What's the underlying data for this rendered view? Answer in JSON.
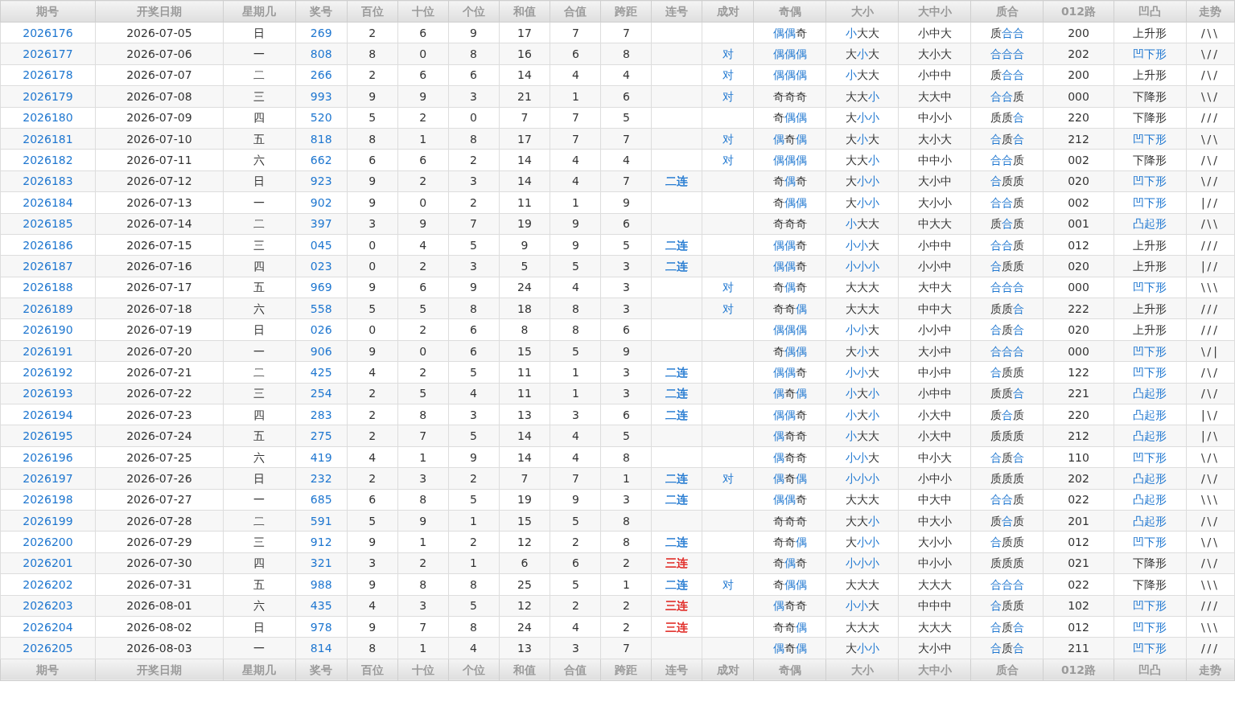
{
  "header": [
    "期号",
    "开奖日期",
    "星期几",
    "奖号",
    "百位",
    "十位",
    "个位",
    "和值",
    "合值",
    "跨距",
    "连号",
    "成对",
    "奇偶",
    "大小",
    "大中小",
    "质合",
    "012路",
    "凹凸",
    "走势"
  ],
  "rows": [
    {
      "issue": "2026176",
      "date": "2026-07-05",
      "weekday": "日",
      "number": "269",
      "hundreds": "2",
      "tens": "6",
      "units": "9",
      "sum": "17",
      "sum_tail": "7",
      "span": "7",
      "odd_even": [
        {
          "t": "偶偶",
          "hot": true
        },
        {
          "t": "奇",
          "hot": false
        }
      ],
      "big_small": [
        {
          "t": "小",
          "hot": true
        },
        {
          "t": "大大",
          "hot": false
        }
      ],
      "big_mid_small": "小中大",
      "prime": [
        {
          "t": "质",
          "hot": false
        },
        {
          "t": "合合",
          "hot": true
        }
      ],
      "road": "200",
      "shape": {
        "text": "上升形",
        "hot": false
      },
      "trend": "/\\\\"
    },
    {
      "issue": "2026177",
      "date": "2026-07-06",
      "weekday": "一",
      "number": "808",
      "hundreds": "8",
      "tens": "0",
      "units": "8",
      "sum": "16",
      "sum_tail": "6",
      "span": "8",
      "pair": "对",
      "odd_even": [
        {
          "t": "偶偶偶",
          "hot": true
        }
      ],
      "big_small": [
        {
          "t": "大",
          "hot": false
        },
        {
          "t": "小",
          "hot": true
        },
        {
          "t": "大",
          "hot": false
        }
      ],
      "big_mid_small": "大小大",
      "prime": [
        {
          "t": "合合合",
          "hot": true
        }
      ],
      "road": "202",
      "shape": {
        "text": "凹下形",
        "hot": true
      },
      "trend": "\\//"
    },
    {
      "issue": "2026178",
      "date": "2026-07-07",
      "weekday": "二",
      "number": "266",
      "hundreds": "2",
      "tens": "6",
      "units": "6",
      "sum": "14",
      "sum_tail": "4",
      "span": "4",
      "pair": "对",
      "odd_even": [
        {
          "t": "偶偶偶",
          "hot": true
        }
      ],
      "big_small": [
        {
          "t": "小",
          "hot": true
        },
        {
          "t": "大大",
          "hot": false
        }
      ],
      "big_mid_small": "小中中",
      "prime": [
        {
          "t": "质",
          "hot": false
        },
        {
          "t": "合合",
          "hot": true
        }
      ],
      "road": "200",
      "shape": {
        "text": "上升形",
        "hot": false
      },
      "trend": "/\\/"
    },
    {
      "issue": "2026179",
      "date": "2026-07-08",
      "weekday": "三",
      "number": "993",
      "hundreds": "9",
      "tens": "9",
      "units": "3",
      "sum": "21",
      "sum_tail": "1",
      "span": "6",
      "pair": "对",
      "odd_even": [
        {
          "t": "奇奇奇",
          "hot": false
        }
      ],
      "big_small": [
        {
          "t": "大大",
          "hot": false
        },
        {
          "t": "小",
          "hot": true
        }
      ],
      "big_mid_small": "大大中",
      "prime": [
        {
          "t": "合合",
          "hot": true
        },
        {
          "t": "质",
          "hot": false
        }
      ],
      "road": "000",
      "shape": {
        "text": "下降形",
        "hot": false
      },
      "trend": "\\\\/"
    },
    {
      "issue": "2026180",
      "date": "2026-07-09",
      "weekday": "四",
      "number": "520",
      "hundreds": "5",
      "tens": "2",
      "units": "0",
      "sum": "7",
      "sum_tail": "7",
      "span": "5",
      "odd_even": [
        {
          "t": "奇",
          "hot": false
        },
        {
          "t": "偶偶",
          "hot": true
        }
      ],
      "big_small": [
        {
          "t": "大",
          "hot": false
        },
        {
          "t": "小小",
          "hot": true
        }
      ],
      "big_mid_small": "中小小",
      "prime": [
        {
          "t": "质质",
          "hot": false
        },
        {
          "t": "合",
          "hot": true
        }
      ],
      "road": "220",
      "shape": {
        "text": "下降形",
        "hot": false
      },
      "trend": "///"
    },
    {
      "issue": "2026181",
      "date": "2026-07-10",
      "weekday": "五",
      "number": "818",
      "hundreds": "8",
      "tens": "1",
      "units": "8",
      "sum": "17",
      "sum_tail": "7",
      "span": "7",
      "pair": "对",
      "odd_even": [
        {
          "t": "偶",
          "hot": true
        },
        {
          "t": "奇",
          "hot": false
        },
        {
          "t": "偶",
          "hot": true
        }
      ],
      "big_small": [
        {
          "t": "大",
          "hot": false
        },
        {
          "t": "小",
          "hot": true
        },
        {
          "t": "大",
          "hot": false
        }
      ],
      "big_mid_small": "大小大",
      "prime": [
        {
          "t": "合",
          "hot": true
        },
        {
          "t": "质",
          "hot": false
        },
        {
          "t": "合",
          "hot": true
        }
      ],
      "road": "212",
      "shape": {
        "text": "凹下形",
        "hot": true
      },
      "trend": "\\/\\"
    },
    {
      "issue": "2026182",
      "date": "2026-07-11",
      "weekday": "六",
      "number": "662",
      "hundreds": "6",
      "tens": "6",
      "units": "2",
      "sum": "14",
      "sum_tail": "4",
      "span": "4",
      "pair": "对",
      "odd_even": [
        {
          "t": "偶偶偶",
          "hot": true
        }
      ],
      "big_small": [
        {
          "t": "大大",
          "hot": false
        },
        {
          "t": "小",
          "hot": true
        }
      ],
      "big_mid_small": "中中小",
      "prime": [
        {
          "t": "合合",
          "hot": true
        },
        {
          "t": "质",
          "hot": false
        }
      ],
      "road": "002",
      "shape": {
        "text": "下降形",
        "hot": false
      },
      "trend": "/\\/"
    },
    {
      "issue": "2026183",
      "date": "2026-07-12",
      "weekday": "日",
      "number": "923",
      "hundreds": "9",
      "tens": "2",
      "units": "3",
      "sum": "14",
      "sum_tail": "4",
      "span": "7",
      "consec": {
        "text": "二连",
        "color": "#1f77d0"
      },
      "odd_even": [
        {
          "t": "奇",
          "hot": false
        },
        {
          "t": "偶",
          "hot": true
        },
        {
          "t": "奇",
          "hot": false
        }
      ],
      "big_small": [
        {
          "t": "大",
          "hot": false
        },
        {
          "t": "小小",
          "hot": true
        }
      ],
      "big_mid_small": "大小中",
      "prime": [
        {
          "t": "合",
          "hot": true
        },
        {
          "t": "质质",
          "hot": false
        }
      ],
      "road": "020",
      "shape": {
        "text": "凹下形",
        "hot": true
      },
      "trend": "\\//"
    },
    {
      "issue": "2026184",
      "date": "2026-07-13",
      "weekday": "一",
      "number": "902",
      "hundreds": "9",
      "tens": "0",
      "units": "2",
      "sum": "11",
      "sum_tail": "1",
      "span": "9",
      "odd_even": [
        {
          "t": "奇",
          "hot": false
        },
        {
          "t": "偶偶",
          "hot": true
        }
      ],
      "big_small": [
        {
          "t": "大",
          "hot": false
        },
        {
          "t": "小小",
          "hot": true
        }
      ],
      "big_mid_small": "大小小",
      "prime": [
        {
          "t": "合合",
          "hot": true
        },
        {
          "t": "质",
          "hot": false
        }
      ],
      "road": "002",
      "shape": {
        "text": "凹下形",
        "hot": true
      },
      "trend": "|//"
    },
    {
      "issue": "2026185",
      "date": "2026-07-14",
      "weekday": "二",
      "number": "397",
      "hundreds": "3",
      "tens": "9",
      "units": "7",
      "sum": "19",
      "sum_tail": "9",
      "span": "6",
      "odd_even": [
        {
          "t": "奇奇奇",
          "hot": false
        }
      ],
      "big_small": [
        {
          "t": "小",
          "hot": true
        },
        {
          "t": "大大",
          "hot": false
        }
      ],
      "big_mid_small": "中大大",
      "prime": [
        {
          "t": "质",
          "hot": false
        },
        {
          "t": "合",
          "hot": true
        },
        {
          "t": "质",
          "hot": false
        }
      ],
      "road": "001",
      "shape": {
        "text": "凸起形",
        "hot": true
      },
      "trend": "/\\\\"
    },
    {
      "issue": "2026186",
      "date": "2026-07-15",
      "weekday": "三",
      "number": "045",
      "hundreds": "0",
      "tens": "4",
      "units": "5",
      "sum": "9",
      "sum_tail": "9",
      "span": "5",
      "consec": {
        "text": "二连",
        "color": "#1f77d0"
      },
      "odd_even": [
        {
          "t": "偶偶",
          "hot": true
        },
        {
          "t": "奇",
          "hot": false
        }
      ],
      "big_small": [
        {
          "t": "小小",
          "hot": true
        },
        {
          "t": "大",
          "hot": false
        }
      ],
      "big_mid_small": "小中中",
      "prime": [
        {
          "t": "合合",
          "hot": true
        },
        {
          "t": "质",
          "hot": false
        }
      ],
      "road": "012",
      "shape": {
        "text": "上升形",
        "hot": false
      },
      "trend": "///"
    },
    {
      "issue": "2026187",
      "date": "2026-07-16",
      "weekday": "四",
      "number": "023",
      "hundreds": "0",
      "tens": "2",
      "units": "3",
      "sum": "5",
      "sum_tail": "5",
      "span": "3",
      "consec": {
        "text": "二连",
        "color": "#1f77d0"
      },
      "odd_even": [
        {
          "t": "偶偶",
          "hot": true
        },
        {
          "t": "奇",
          "hot": false
        }
      ],
      "big_small": [
        {
          "t": "小小小",
          "hot": true
        }
      ],
      "big_mid_small": "小小中",
      "prime": [
        {
          "t": "合",
          "hot": true
        },
        {
          "t": "质质",
          "hot": false
        }
      ],
      "road": "020",
      "shape": {
        "text": "上升形",
        "hot": false
      },
      "trend": "|//"
    },
    {
      "issue": "2026188",
      "date": "2026-07-17",
      "weekday": "五",
      "number": "969",
      "hundreds": "9",
      "tens": "6",
      "units": "9",
      "sum": "24",
      "sum_tail": "4",
      "span": "3",
      "pair": "对",
      "odd_even": [
        {
          "t": "奇",
          "hot": false
        },
        {
          "t": "偶",
          "hot": true
        },
        {
          "t": "奇",
          "hot": false
        }
      ],
      "big_small": [
        {
          "t": "大大大",
          "hot": false
        }
      ],
      "big_mid_small": "大中大",
      "prime": [
        {
          "t": "合合合",
          "hot": true
        }
      ],
      "road": "000",
      "shape": {
        "text": "凹下形",
        "hot": true
      },
      "trend": "\\\\\\"
    },
    {
      "issue": "2026189",
      "date": "2026-07-18",
      "weekday": "六",
      "number": "558",
      "hundreds": "5",
      "tens": "5",
      "units": "8",
      "sum": "18",
      "sum_tail": "8",
      "span": "3",
      "pair": "对",
      "odd_even": [
        {
          "t": "奇奇",
          "hot": false
        },
        {
          "t": "偶",
          "hot": true
        }
      ],
      "big_small": [
        {
          "t": "大大大",
          "hot": false
        }
      ],
      "big_mid_small": "中中大",
      "prime": [
        {
          "t": "质质",
          "hot": false
        },
        {
          "t": "合",
          "hot": true
        }
      ],
      "road": "222",
      "shape": {
        "text": "上升形",
        "hot": false
      },
      "trend": "///"
    },
    {
      "issue": "2026190",
      "date": "2026-07-19",
      "weekday": "日",
      "number": "026",
      "hundreds": "0",
      "tens": "2",
      "units": "6",
      "sum": "8",
      "sum_tail": "8",
      "span": "6",
      "odd_even": [
        {
          "t": "偶偶偶",
          "hot": true
        }
      ],
      "big_small": [
        {
          "t": "小小",
          "hot": true
        },
        {
          "t": "大",
          "hot": false
        }
      ],
      "big_mid_small": "小小中",
      "prime": [
        {
          "t": "合",
          "hot": true
        },
        {
          "t": "质",
          "hot": false
        },
        {
          "t": "合",
          "hot": true
        }
      ],
      "road": "020",
      "shape": {
        "text": "上升形",
        "hot": false
      },
      "trend": "///"
    },
    {
      "issue": "2026191",
      "date": "2026-07-20",
      "weekday": "一",
      "number": "906",
      "hundreds": "9",
      "tens": "0",
      "units": "6",
      "sum": "15",
      "sum_tail": "5",
      "span": "9",
      "odd_even": [
        {
          "t": "奇",
          "hot": false
        },
        {
          "t": "偶偶",
          "hot": true
        }
      ],
      "big_small": [
        {
          "t": "大",
          "hot": false
        },
        {
          "t": "小",
          "hot": true
        },
        {
          "t": "大",
          "hot": false
        }
      ],
      "big_mid_small": "大小中",
      "prime": [
        {
          "t": "合合合",
          "hot": true
        }
      ],
      "road": "000",
      "shape": {
        "text": "凹下形",
        "hot": true
      },
      "trend": "\\/|"
    },
    {
      "issue": "2026192",
      "date": "2026-07-21",
      "weekday": "二",
      "number": "425",
      "hundreds": "4",
      "tens": "2",
      "units": "5",
      "sum": "11",
      "sum_tail": "1",
      "span": "3",
      "consec": {
        "text": "二连",
        "color": "#1f77d0"
      },
      "odd_even": [
        {
          "t": "偶偶",
          "hot": true
        },
        {
          "t": "奇",
          "hot": false
        }
      ],
      "big_small": [
        {
          "t": "小小",
          "hot": true
        },
        {
          "t": "大",
          "hot": false
        }
      ],
      "big_mid_small": "中小中",
      "prime": [
        {
          "t": "合",
          "hot": true
        },
        {
          "t": "质质",
          "hot": false
        }
      ],
      "road": "122",
      "shape": {
        "text": "凹下形",
        "hot": true
      },
      "trend": "/\\/"
    },
    {
      "issue": "2026193",
      "date": "2026-07-22",
      "weekday": "三",
      "number": "254",
      "hundreds": "2",
      "tens": "5",
      "units": "4",
      "sum": "11",
      "sum_tail": "1",
      "span": "3",
      "consec": {
        "text": "二连",
        "color": "#1f77d0"
      },
      "odd_even": [
        {
          "t": "偶",
          "hot": true
        },
        {
          "t": "奇",
          "hot": false
        },
        {
          "t": "偶",
          "hot": true
        }
      ],
      "big_small": [
        {
          "t": "小",
          "hot": true
        },
        {
          "t": "大",
          "hot": false
        },
        {
          "t": "小",
          "hot": true
        }
      ],
      "big_mid_small": "小中中",
      "prime": [
        {
          "t": "质质",
          "hot": false
        },
        {
          "t": "合",
          "hot": true
        }
      ],
      "road": "221",
      "shape": {
        "text": "凸起形",
        "hot": true
      },
      "trend": "/\\/"
    },
    {
      "issue": "2026194",
      "date": "2026-07-23",
      "weekday": "四",
      "number": "283",
      "hundreds": "2",
      "tens": "8",
      "units": "3",
      "sum": "13",
      "sum_tail": "3",
      "span": "6",
      "consec": {
        "text": "二连",
        "color": "#1f77d0"
      },
      "odd_even": [
        {
          "t": "偶偶",
          "hot": true
        },
        {
          "t": "奇",
          "hot": false
        }
      ],
      "big_small": [
        {
          "t": "小",
          "hot": true
        },
        {
          "t": "大",
          "hot": false
        },
        {
          "t": "小",
          "hot": true
        }
      ],
      "big_mid_small": "小大中",
      "prime": [
        {
          "t": "质",
          "hot": false
        },
        {
          "t": "合",
          "hot": true
        },
        {
          "t": "质",
          "hot": false
        }
      ],
      "road": "220",
      "shape": {
        "text": "凸起形",
        "hot": true
      },
      "trend": "|\\/"
    },
    {
      "issue": "2026195",
      "date": "2026-07-24",
      "weekday": "五",
      "number": "275",
      "hundreds": "2",
      "tens": "7",
      "units": "5",
      "sum": "14",
      "sum_tail": "4",
      "span": "5",
      "odd_even": [
        {
          "t": "偶",
          "hot": true
        },
        {
          "t": "奇奇",
          "hot": false
        }
      ],
      "big_small": [
        {
          "t": "小",
          "hot": true
        },
        {
          "t": "大大",
          "hot": false
        }
      ],
      "big_mid_small": "小大中",
      "prime": [
        {
          "t": "质质质",
          "hot": false
        }
      ],
      "road": "212",
      "shape": {
        "text": "凸起形",
        "hot": true
      },
      "trend": "|/\\"
    },
    {
      "issue": "2026196",
      "date": "2026-07-25",
      "weekday": "六",
      "number": "419",
      "hundreds": "4",
      "tens": "1",
      "units": "9",
      "sum": "14",
      "sum_tail": "4",
      "span": "8",
      "odd_even": [
        {
          "t": "偶",
          "hot": true
        },
        {
          "t": "奇奇",
          "hot": false
        }
      ],
      "big_small": [
        {
          "t": "小小",
          "hot": true
        },
        {
          "t": "大",
          "hot": false
        }
      ],
      "big_mid_small": "中小大",
      "prime": [
        {
          "t": "合",
          "hot": true
        },
        {
          "t": "质",
          "hot": false
        },
        {
          "t": "合",
          "hot": true
        }
      ],
      "road": "110",
      "shape": {
        "text": "凹下形",
        "hot": true
      },
      "trend": "\\/\\"
    },
    {
      "issue": "2026197",
      "date": "2026-07-26",
      "weekday": "日",
      "number": "232",
      "hundreds": "2",
      "tens": "3",
      "units": "2",
      "sum": "7",
      "sum_tail": "7",
      "span": "1",
      "consec": {
        "text": "二连",
        "color": "#1f77d0"
      },
      "pair": "对",
      "odd_even": [
        {
          "t": "偶",
          "hot": true
        },
        {
          "t": "奇",
          "hot": false
        },
        {
          "t": "偶",
          "hot": true
        }
      ],
      "big_small": [
        {
          "t": "小小小",
          "hot": true
        }
      ],
      "big_mid_small": "小中小",
      "prime": [
        {
          "t": "质质质",
          "hot": false
        }
      ],
      "road": "202",
      "shape": {
        "text": "凸起形",
        "hot": true
      },
      "trend": "/\\/"
    },
    {
      "issue": "2026198",
      "date": "2026-07-27",
      "weekday": "一",
      "number": "685",
      "hundreds": "6",
      "tens": "8",
      "units": "5",
      "sum": "19",
      "sum_tail": "9",
      "span": "3",
      "consec": {
        "text": "二连",
        "color": "#1f77d0"
      },
      "odd_even": [
        {
          "t": "偶偶",
          "hot": true
        },
        {
          "t": "奇",
          "hot": false
        }
      ],
      "big_small": [
        {
          "t": "大大大",
          "hot": false
        }
      ],
      "big_mid_small": "中大中",
      "prime": [
        {
          "t": "合合",
          "hot": true
        },
        {
          "t": "质",
          "hot": false
        }
      ],
      "road": "022",
      "shape": {
        "text": "凸起形",
        "hot": true
      },
      "trend": "\\\\\\"
    },
    {
      "issue": "2026199",
      "date": "2026-07-28",
      "weekday": "二",
      "number": "591",
      "hundreds": "5",
      "tens": "9",
      "units": "1",
      "sum": "15",
      "sum_tail": "5",
      "span": "8",
      "odd_even": [
        {
          "t": "奇奇奇",
          "hot": false
        }
      ],
      "big_small": [
        {
          "t": "大大",
          "hot": false
        },
        {
          "t": "小",
          "hot": true
        }
      ],
      "big_mid_small": "中大小",
      "prime": [
        {
          "t": "质",
          "hot": false
        },
        {
          "t": "合",
          "hot": true
        },
        {
          "t": "质",
          "hot": false
        }
      ],
      "road": "201",
      "shape": {
        "text": "凸起形",
        "hot": true
      },
      "trend": "/\\/"
    },
    {
      "issue": "2026200",
      "date": "2026-07-29",
      "weekday": "三",
      "number": "912",
      "hundreds": "9",
      "tens": "1",
      "units": "2",
      "sum": "12",
      "sum_tail": "2",
      "span": "8",
      "consec": {
        "text": "二连",
        "color": "#1f77d0"
      },
      "odd_even": [
        {
          "t": "奇奇",
          "hot": false
        },
        {
          "t": "偶",
          "hot": true
        }
      ],
      "big_small": [
        {
          "t": "大",
          "hot": false
        },
        {
          "t": "小小",
          "hot": true
        }
      ],
      "big_mid_small": "大小小",
      "prime": [
        {
          "t": "合",
          "hot": true
        },
        {
          "t": "质质",
          "hot": false
        }
      ],
      "road": "012",
      "shape": {
        "text": "凹下形",
        "hot": true
      },
      "trend": "\\/\\"
    },
    {
      "issue": "2026201",
      "date": "2026-07-30",
      "weekday": "四",
      "number": "321",
      "hundreds": "3",
      "tens": "2",
      "units": "1",
      "sum": "6",
      "sum_tail": "6",
      "span": "2",
      "consec": {
        "text": "三连",
        "color": "#e0231f"
      },
      "odd_even": [
        {
          "t": "奇",
          "hot": false
        },
        {
          "t": "偶",
          "hot": true
        },
        {
          "t": "奇",
          "hot": false
        }
      ],
      "big_small": [
        {
          "t": "小小小",
          "hot": true
        }
      ],
      "big_mid_small": "中小小",
      "prime": [
        {
          "t": "质质质",
          "hot": false
        }
      ],
      "road": "021",
      "shape": {
        "text": "下降形",
        "hot": false
      },
      "trend": "/\\/"
    },
    {
      "issue": "2026202",
      "date": "2026-07-31",
      "weekday": "五",
      "number": "988",
      "hundreds": "9",
      "tens": "8",
      "units": "8",
      "sum": "25",
      "sum_tail": "5",
      "span": "1",
      "consec": {
        "text": "二连",
        "color": "#1f77d0"
      },
      "pair": "对",
      "odd_even": [
        {
          "t": "奇",
          "hot": false
        },
        {
          "t": "偶偶",
          "hot": true
        }
      ],
      "big_small": [
        {
          "t": "大大大",
          "hot": false
        }
      ],
      "big_mid_small": "大大大",
      "prime": [
        {
          "t": "合合合",
          "hot": true
        }
      ],
      "road": "022",
      "shape": {
        "text": "下降形",
        "hot": false
      },
      "trend": "\\\\\\"
    },
    {
      "issue": "2026203",
      "date": "2026-08-01",
      "weekday": "六",
      "number": "435",
      "hundreds": "4",
      "tens": "3",
      "units": "5",
      "sum": "12",
      "sum_tail": "2",
      "span": "2",
      "consec": {
        "text": "三连",
        "color": "#e0231f"
      },
      "odd_even": [
        {
          "t": "偶",
          "hot": true
        },
        {
          "t": "奇奇",
          "hot": false
        }
      ],
      "big_small": [
        {
          "t": "小小",
          "hot": true
        },
        {
          "t": "大",
          "hot": false
        }
      ],
      "big_mid_small": "中中中",
      "prime": [
        {
          "t": "合",
          "hot": true
        },
        {
          "t": "质质",
          "hot": false
        }
      ],
      "road": "102",
      "shape": {
        "text": "凹下形",
        "hot": true
      },
      "trend": "///"
    },
    {
      "issue": "2026204",
      "date": "2026-08-02",
      "weekday": "日",
      "number": "978",
      "hundreds": "9",
      "tens": "7",
      "units": "8",
      "sum": "24",
      "sum_tail": "4",
      "span": "2",
      "consec": {
        "text": "三连",
        "color": "#e0231f"
      },
      "odd_even": [
        {
          "t": "奇奇",
          "hot": false
        },
        {
          "t": "偶",
          "hot": true
        }
      ],
      "big_small": [
        {
          "t": "大大大",
          "hot": false
        }
      ],
      "big_mid_small": "大大大",
      "prime": [
        {
          "t": "合",
          "hot": true
        },
        {
          "t": "质",
          "hot": false
        },
        {
          "t": "合",
          "hot": true
        }
      ],
      "road": "012",
      "shape": {
        "text": "凹下形",
        "hot": true
      },
      "trend": "\\\\\\"
    },
    {
      "issue": "2026205",
      "date": "2026-08-03",
      "weekday": "一",
      "number": "814",
      "hundreds": "8",
      "tens": "1",
      "units": "4",
      "sum": "13",
      "sum_tail": "3",
      "span": "7",
      "odd_even": [
        {
          "t": "偶",
          "hot": true
        },
        {
          "t": "奇",
          "hot": false
        },
        {
          "t": "偶",
          "hot": true
        }
      ],
      "big_small": [
        {
          "t": "大",
          "hot": false
        },
        {
          "t": "小小",
          "hot": true
        }
      ],
      "big_mid_small": "大小中",
      "prime": [
        {
          "t": "合",
          "hot": true
        },
        {
          "t": "质",
          "hot": false
        },
        {
          "t": "合",
          "hot": true
        }
      ],
      "road": "211",
      "shape": {
        "text": "凹下形",
        "hot": true
      },
      "trend": "///"
    }
  ],
  "footer_header": [
    "期号",
    "开奖日期",
    "星期几",
    "奖号",
    "百位",
    "十位",
    "个位",
    "和值",
    "合值",
    "跨距",
    "连号",
    "成对",
    "奇偶",
    "大小",
    "大中小",
    "质合",
    "012路",
    "凹凸",
    "走势"
  ]
}
